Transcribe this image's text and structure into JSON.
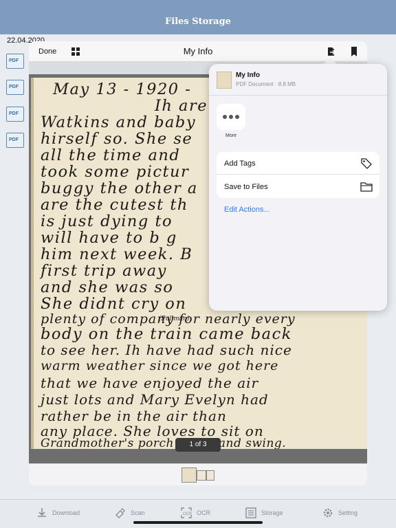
{
  "app": {
    "title": "Files Storage"
  },
  "background": {
    "date": "22.04.2020",
    "pdf_label": "PDF"
  },
  "sheet": {
    "done_label": "Done",
    "title": "My Info",
    "page_counter": "1 of 3"
  },
  "letter": {
    "lines": [
      "May 13 - 1920 -",
      "Ih are a",
      "Watkins and baby",
      "hirself so. She se",
      "all the time and",
      "took some pictur",
      "buggy the other a",
      "are the cutest th",
      "is just dying to",
      "will have to b g",
      "him next week. B",
      "first trip away",
      "and she was so",
      "She didnt cry on",
      "plenty of company for nearly every",
      "body on the train came back",
      "to see her. Ih have had such nice",
      "warm weather since we got here",
      "that we have enjoyed the air",
      "just lots and Mary Evelyn had",
      "rather be in the air than",
      "any place. She loves to sit on",
      "Grandmother's porch swing and swing."
    ],
    "insert": "(Pullman)"
  },
  "share_sheet": {
    "file_name": "My Info",
    "file_meta": "PDF Document · 8.8 MB",
    "more_label": "More",
    "actions": [
      {
        "label": "Add Tags",
        "icon": "tag-icon"
      },
      {
        "label": "Save to Files",
        "icon": "folder-icon"
      }
    ],
    "edit_actions_label": "Edit Actions...",
    "link_color": "#2f7cf6"
  },
  "tabbar": {
    "items": [
      {
        "label": "Download",
        "icon": "download-icon"
      },
      {
        "label": "Scan",
        "icon": "scan-icon"
      },
      {
        "label": "OCR",
        "icon": "ocr-icon"
      },
      {
        "label": "Storage",
        "icon": "storage-icon"
      },
      {
        "label": "Setting",
        "icon": "gear-icon"
      }
    ]
  },
  "colors": {
    "header": "#7f9cbe",
    "accent": "#2f7cf6"
  }
}
